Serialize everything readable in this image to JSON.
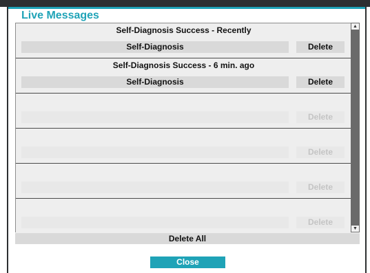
{
  "dialog": {
    "title": "Live Messages",
    "accent_color": "#1fa3b7",
    "frame_color": "#2d2f31"
  },
  "messages": [
    {
      "title": "Self-Diagnosis Success - Recently",
      "action_label": "Self-Diagnosis",
      "delete_label": "Delete"
    },
    {
      "title": "Self-Diagnosis Success - 6 min. ago",
      "action_label": "Self-Diagnosis",
      "delete_label": "Delete"
    },
    {
      "title": "",
      "action_label": "",
      "delete_label": "Delete"
    },
    {
      "title": "",
      "action_label": "",
      "delete_label": "Delete"
    },
    {
      "title": "",
      "action_label": "",
      "delete_label": "Delete"
    },
    {
      "title": "",
      "action_label": "",
      "delete_label": "Delete"
    }
  ],
  "scrollbar": {
    "up_icon": "scroll-up-arrow",
    "down_icon": "scroll-down-arrow"
  },
  "footer": {
    "delete_all_label": "Delete All",
    "close_label": "Close"
  }
}
